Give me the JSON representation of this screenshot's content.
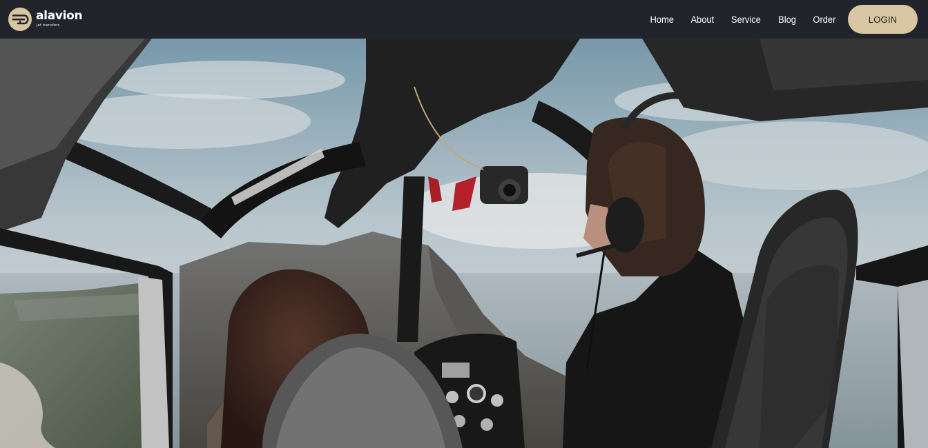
{
  "brand": {
    "name": "alavion",
    "tagline": "jet transfers",
    "logo_icon": "alavion-logo-icon"
  },
  "nav": {
    "links": [
      "Home",
      "About",
      "Service",
      "Blog",
      "Order"
    ],
    "login_label": "LOGIN"
  },
  "hero": {
    "image": "helicopter-cockpit-photo",
    "description_icon": "hero-photo"
  },
  "colors": {
    "navbar_bg": "#21252b",
    "login_bg": "#d8c6a2",
    "nav_text": "#ffffff"
  }
}
